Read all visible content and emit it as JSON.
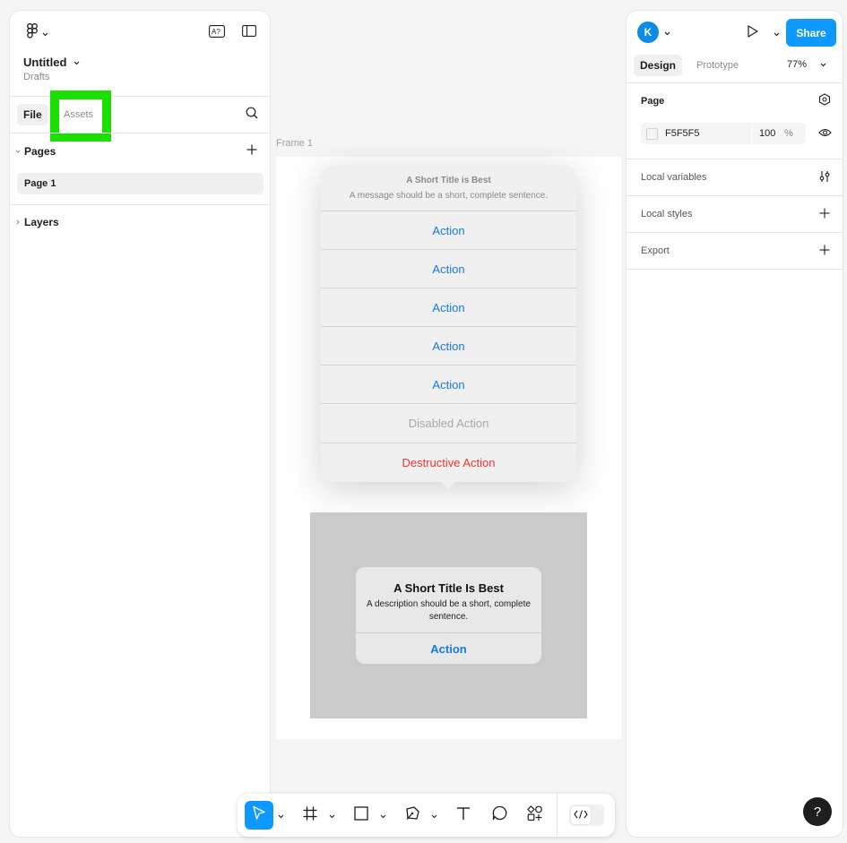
{
  "left_panel": {
    "file_title": "Untitled",
    "file_location": "Drafts",
    "tabs": [
      {
        "label": "File"
      },
      {
        "label": "Assets"
      }
    ],
    "pages_label": "Pages",
    "pages": [
      {
        "label": "Page 1"
      }
    ],
    "layers_label": "Layers"
  },
  "canvas": {
    "frame_label": "Frame 1",
    "popover": {
      "title": "A Short Title is Best",
      "message": "A message should be a short, complete sentence.",
      "actions": [
        {
          "label": "Action",
          "state": "default"
        },
        {
          "label": "Action",
          "state": "default"
        },
        {
          "label": "Action",
          "state": "default"
        },
        {
          "label": "Action",
          "state": "default"
        },
        {
          "label": "Action",
          "state": "default"
        },
        {
          "label": "Disabled Action",
          "state": "disabled"
        },
        {
          "label": "Destructive Action",
          "state": "destructive"
        }
      ]
    },
    "alert": {
      "title": "A Short Title Is Best",
      "description": "A description should be a short, complete sentence.",
      "action": "Action"
    }
  },
  "right_panel": {
    "avatar_initial": "K",
    "share_label": "Share",
    "tabs": [
      {
        "label": "Design"
      },
      {
        "label": "Prototype"
      }
    ],
    "zoom": "77%",
    "page_section_label": "Page",
    "page_color": "F5F5F5",
    "page_opacity": "100",
    "page_opacity_unit": "%",
    "local_variables_label": "Local variables",
    "local_styles_label": "Local styles",
    "export_label": "Export"
  },
  "help_label": "?",
  "colors": {
    "accent": "#0d99ff",
    "highlight": "#1bdf00",
    "ios_blue": "#147ce0",
    "destructive": "#ee3533",
    "avatar": "#0c8ce9"
  }
}
